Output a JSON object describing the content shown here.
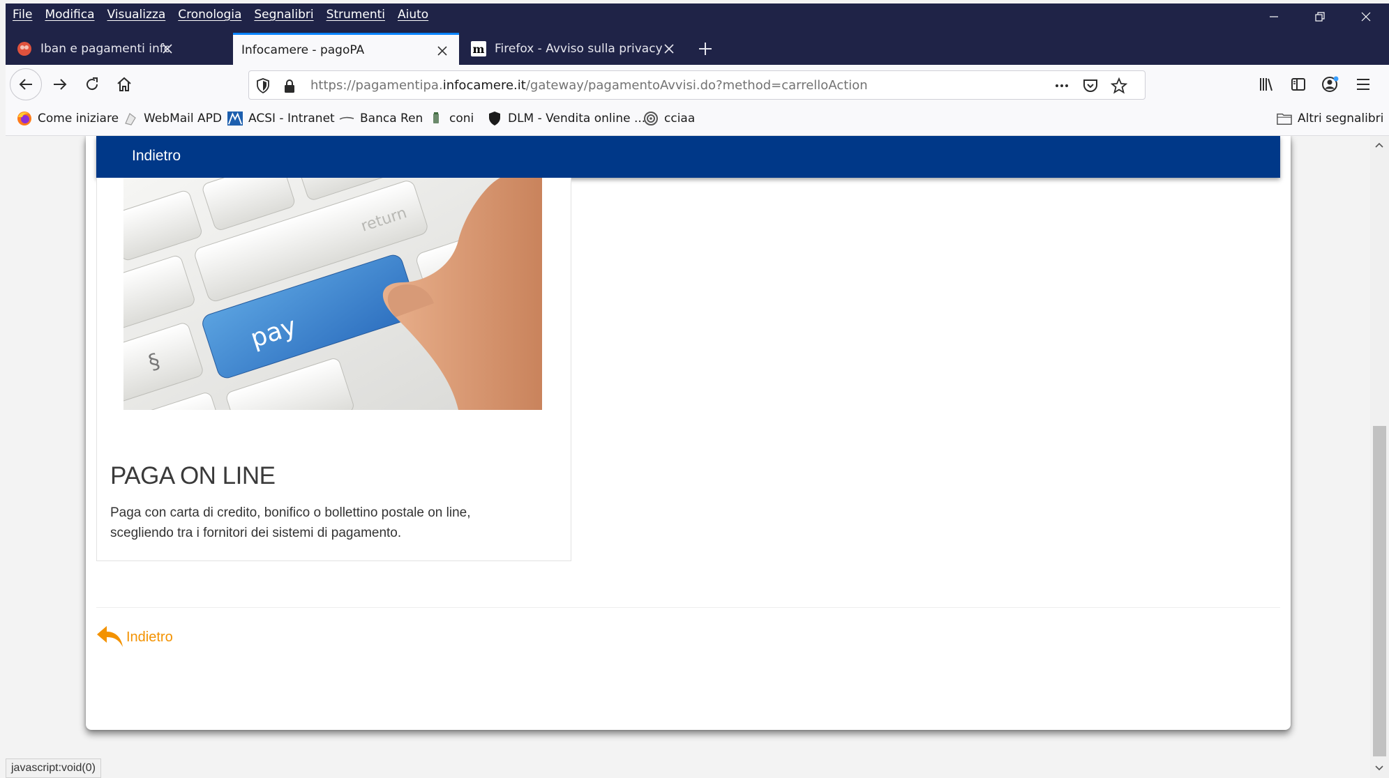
{
  "window": {
    "menu": [
      "File",
      "Modifica",
      "Visualizza",
      "Cronologia",
      "Segnalibri",
      "Strumenti",
      "Aiuto"
    ],
    "controls": [
      "minimize-icon",
      "restore-icon",
      "close-icon"
    ]
  },
  "tabs": [
    {
      "title": "Iban e pagamenti informatici |",
      "favicon": "red-circle-favicon",
      "active": false
    },
    {
      "title": "Infocamere - pagoPA",
      "favicon": "none",
      "active": true
    },
    {
      "title": "Firefox - Avviso sulla privacy —",
      "favicon": "m-favicon",
      "active": false
    }
  ],
  "nav": {
    "url_prefix": "https://pagamentipa.",
    "url_host": "infocamere.it",
    "url_path": "/gateway/pagamentoAvvisi.do?method=carrelloAction"
  },
  "bookmarks": [
    {
      "label": "Come iniziare",
      "icon": "firefox-icon"
    },
    {
      "label": "WebMail APD",
      "icon": "webmail-icon"
    },
    {
      "label": "ACSI - Intranet",
      "icon": "acsi-icon"
    },
    {
      "label": "Banca Ren",
      "icon": "bank-icon"
    },
    {
      "label": "coni",
      "icon": "coni-icon"
    },
    {
      "label": "DLM - Vendita online ...",
      "icon": "shield-icon"
    },
    {
      "label": "cciaa",
      "icon": "cciaa-icon"
    }
  ],
  "other_bookmarks": "Altri segnalibri",
  "page": {
    "header_back": "Indietro",
    "tile": {
      "image_key": "pay",
      "image_keys_other": [
        "return",
        "§"
      ],
      "title": "PAGA ON LINE",
      "description": "Paga con carta di credito, bonifico o bollettino postale on line, scegliendo tra i fornitori dei sistemi di pagamento."
    },
    "footer_back": "Indietro"
  },
  "status_bar": "javascript:void(0)",
  "colors": {
    "chrome": "#1f2347",
    "header_blue": "#003888",
    "link_orange": "#f39200"
  }
}
